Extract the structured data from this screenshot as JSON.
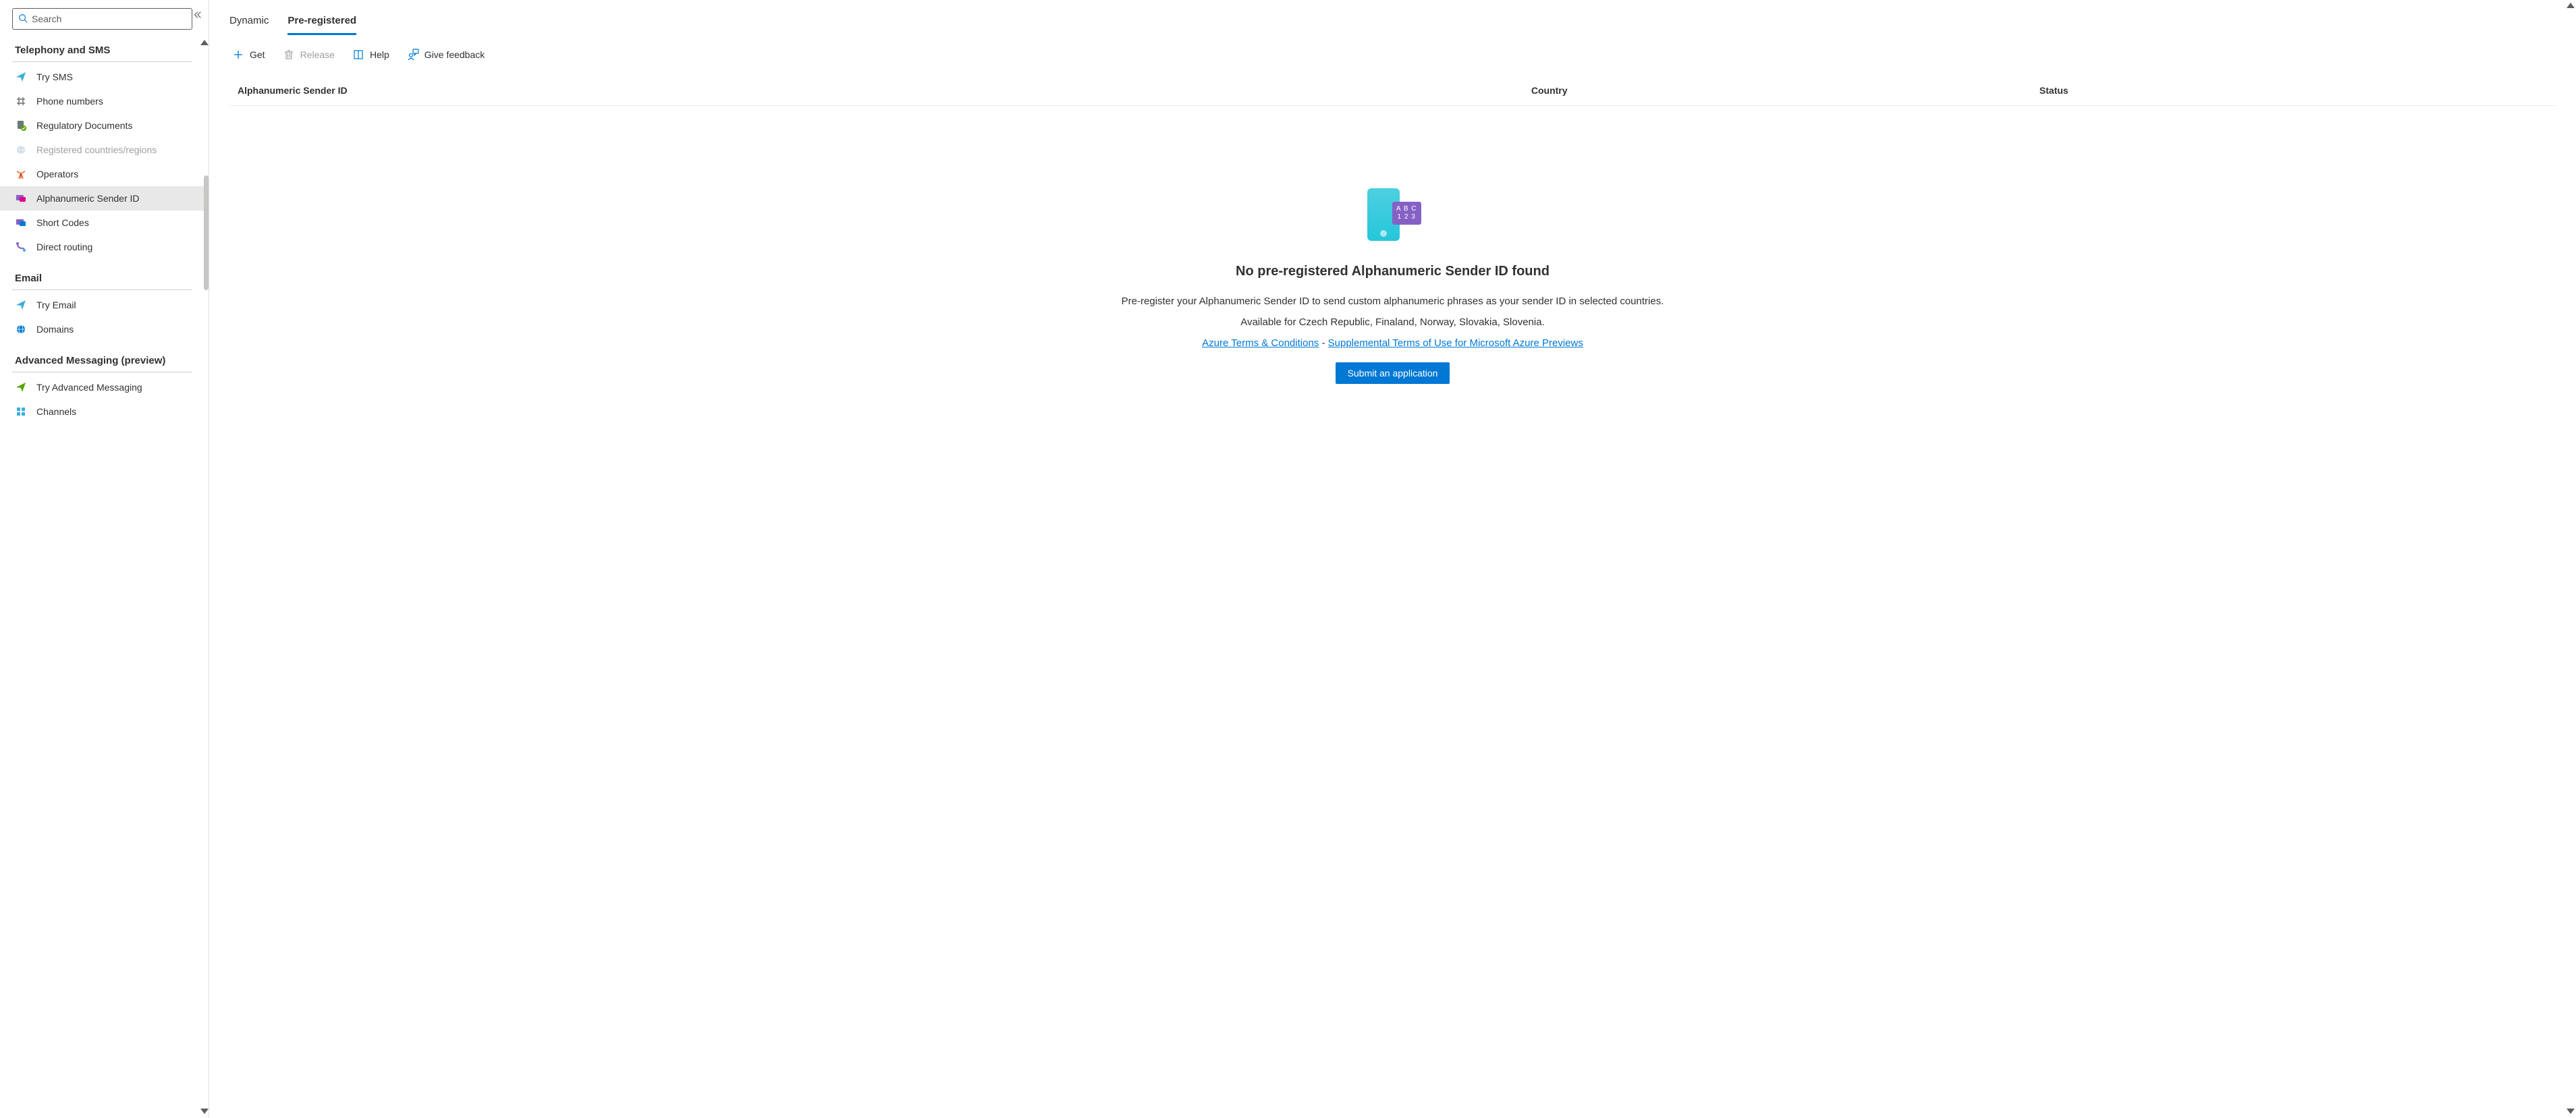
{
  "search": {
    "placeholder": "Search"
  },
  "sidebar": {
    "groups": [
      {
        "title": "Telephony and SMS",
        "items": [
          {
            "label": "Try SMS"
          },
          {
            "label": "Phone numbers"
          },
          {
            "label": "Regulatory Documents"
          },
          {
            "label": "Registered countries/regions",
            "disabled": true
          },
          {
            "label": "Operators"
          },
          {
            "label": "Alphanumeric Sender ID",
            "active": true
          },
          {
            "label": "Short Codes"
          },
          {
            "label": "Direct routing"
          }
        ]
      },
      {
        "title": "Email",
        "items": [
          {
            "label": "Try Email"
          },
          {
            "label": "Domains"
          }
        ]
      },
      {
        "title": "Advanced Messaging (preview)",
        "items": [
          {
            "label": "Try Advanced Messaging"
          },
          {
            "label": "Channels"
          }
        ]
      }
    ]
  },
  "tabs": [
    {
      "label": "Dynamic"
    },
    {
      "label": "Pre-registered",
      "active": true
    }
  ],
  "toolbar": {
    "get": "Get",
    "release": "Release",
    "help": "Help",
    "feedback": "Give feedback"
  },
  "table": {
    "col_sender": "Alphanumeric Sender ID",
    "col_country": "Country",
    "col_status": "Status"
  },
  "empty": {
    "abc1": "A B C",
    "abc2": "1 2 3",
    "title": "No pre-registered Alphanumeric Sender ID found",
    "desc1": "Pre-register your Alphanumeric Sender ID to send custom alphanumeric phrases as your sender ID in selected countries.",
    "desc2": "Available for Czech Republic, Finaland, Norway, Slovakia, Slovenia.",
    "link1": "Azure Terms & Conditions",
    "sep": " - ",
    "link2": "Supplemental Terms of Use for Microsoft Azure Previews",
    "button": "Submit an application"
  }
}
